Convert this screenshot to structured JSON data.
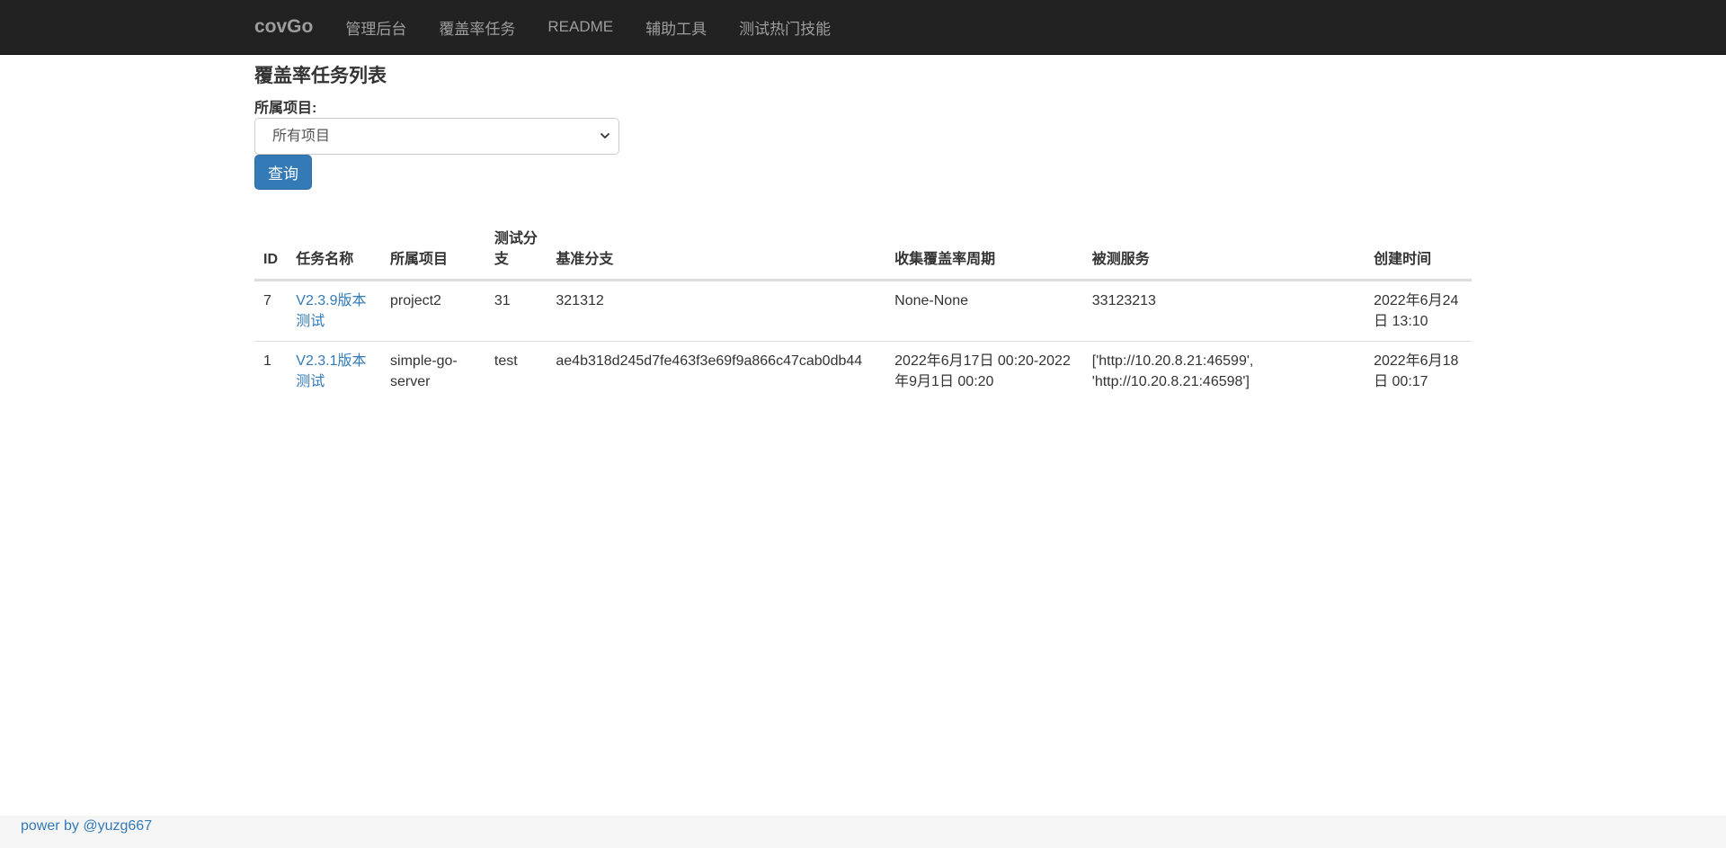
{
  "navbar": {
    "brand": "covGo",
    "links": [
      "管理后台",
      "覆盖率任务",
      "README",
      "辅助工具",
      "测试热门技能"
    ]
  },
  "page": {
    "title": "覆盖率任务列表",
    "project_label": "所属项目:",
    "project_select_value": "所有项目",
    "query_button": "查询"
  },
  "table": {
    "headers": [
      "ID",
      "任务名称",
      "所属项目",
      "测试分支",
      "基准分支",
      "收集覆盖率周期",
      "被测服务",
      "创建时间"
    ],
    "rows": [
      {
        "id": "7",
        "name": "V2.3.9版本测试",
        "project": "project2",
        "test_branch": "31",
        "base_branch": "321312",
        "period": "None-None",
        "service": "33123213",
        "created": "2022年6月24日 13:10"
      },
      {
        "id": "1",
        "name": "V2.3.1版本测试",
        "project": "simple-go-server",
        "test_branch": "test",
        "base_branch": "ae4b318d245d7fe463f3e69f9a866c47cab0db44",
        "period": "2022年6月17日 00:20-2022年9月1日 00:20",
        "service": "['http://10.20.8.21:46599', 'http://10.20.8.21:46598']",
        "created": "2022年6月18日 00:17"
      }
    ]
  },
  "footer": {
    "text": "power by @yuzg667"
  },
  "colors": {
    "navbar_bg": "#222222",
    "nav_text": "#9d9d9d",
    "primary": "#337ab7",
    "footer_bg": "#f5f5f5"
  }
}
